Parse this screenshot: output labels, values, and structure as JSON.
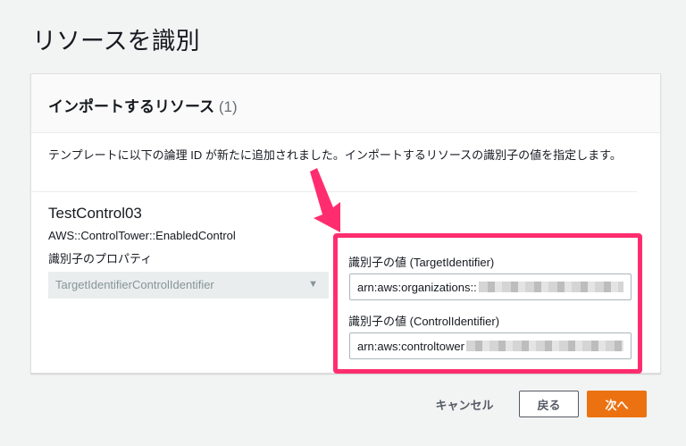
{
  "page_title": "リソースを識別",
  "card": {
    "title": "インポートするリソース",
    "count": "(1)",
    "description": "テンプレートに以下の論理 ID が新たに追加されました。インポートするリソースの識別子の値を指定します。",
    "resource": {
      "logical_id": "TestControl03",
      "type": "AWS::ControlTower::EnabledControl",
      "property_label": "識別子のプロパティ",
      "property_value": "TargetIdentifierControlIdentifier"
    },
    "fields": [
      {
        "label": "識別子の値 (TargetIdentifier)",
        "value": "arn:aws:organizations::"
      },
      {
        "label": "識別子の値 (ControlIdentifier)",
        "value": "arn:aws:controltower"
      }
    ]
  },
  "buttons": {
    "cancel": "キャンセル",
    "back": "戻る",
    "next": "次へ"
  },
  "colors": {
    "accent": "#ec7211",
    "highlight": "#ff2d6f"
  }
}
